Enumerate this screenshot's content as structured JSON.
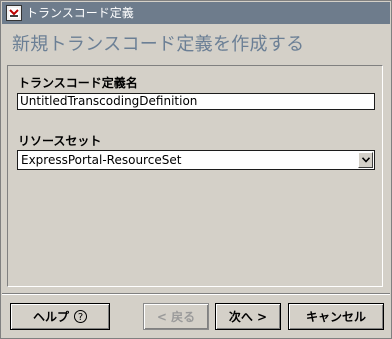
{
  "window": {
    "title": "トランスコード定義"
  },
  "header": {
    "title": "新規トランスコード定義を作成する"
  },
  "form": {
    "name_label": "トランスコード定義名",
    "name_value": "UntitledTranscodingDefinition",
    "resource_label": "リソースセット",
    "resource_value": "ExpressPortal-ResourceSet"
  },
  "buttons": {
    "help": "ヘルプ",
    "help_icon": "?",
    "back": "< 戻る",
    "next": "次へ >",
    "cancel": "キャンセル"
  },
  "colors": {
    "titlebar": "#6e7c8c",
    "header_text": "#6b7f95",
    "dialog_bg": "#d4d0c8"
  },
  "icons": {
    "app": "app-icon",
    "dropdown": "chevron-down-icon",
    "help": "question-icon"
  }
}
